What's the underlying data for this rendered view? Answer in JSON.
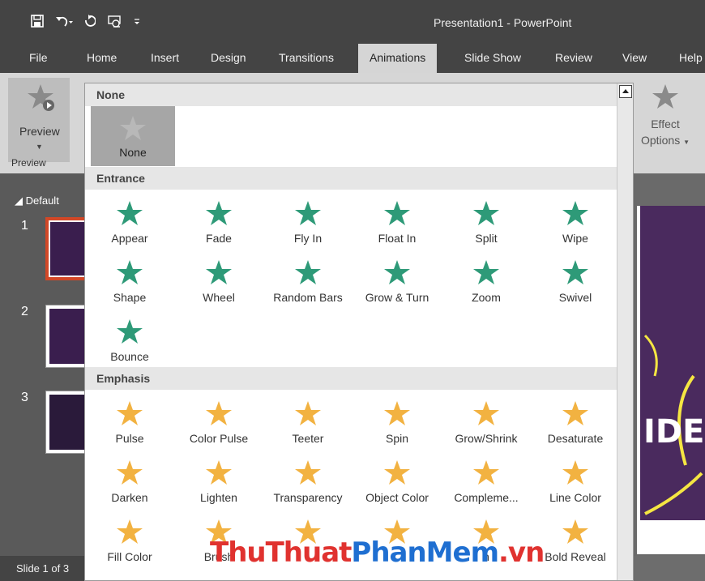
{
  "window": {
    "title": "Presentation1 - PowerPoint"
  },
  "tabs": [
    "File",
    "Home",
    "Insert",
    "Design",
    "Transitions",
    "Animations",
    "Slide Show",
    "Review",
    "View",
    "Help"
  ],
  "active_tab": "Animations",
  "ribbon": {
    "preview_label": "Preview",
    "preview_group": "Preview",
    "effect_label_1": "Effect",
    "effect_label_2": "Options"
  },
  "slide_pane": {
    "section": "Default",
    "slide_numbers": [
      "1",
      "2",
      "3"
    ],
    "status": "Slide 1 of 3"
  },
  "slide_preview": {
    "visible_text": "IDE"
  },
  "gallery": {
    "none_header": "None",
    "none_item": "None",
    "entrance_header": "Entrance",
    "entrance": [
      "Appear",
      "Fade",
      "Fly In",
      "Float In",
      "Split",
      "Wipe",
      "Shape",
      "Wheel",
      "Random Bars",
      "Grow & Turn",
      "Zoom",
      "Swivel",
      "Bounce"
    ],
    "emphasis_header": "Emphasis",
    "emphasis": [
      "Pulse",
      "Color Pulse",
      "Teeter",
      "Spin",
      "Grow/Shrink",
      "Desaturate",
      "Darken",
      "Lighten",
      "Transparency",
      "Object Color",
      "Compleme...",
      "Line Color",
      "Fill Color",
      "Brush",
      "",
      "",
      "h",
      "Bold Reveal"
    ],
    "colors": {
      "entrance": "#2e9a78",
      "emphasis": "#f2b241"
    }
  },
  "watermark": {
    "part1": "ThuThuat",
    "part2": "PhanMem",
    "part3": ".vn"
  }
}
